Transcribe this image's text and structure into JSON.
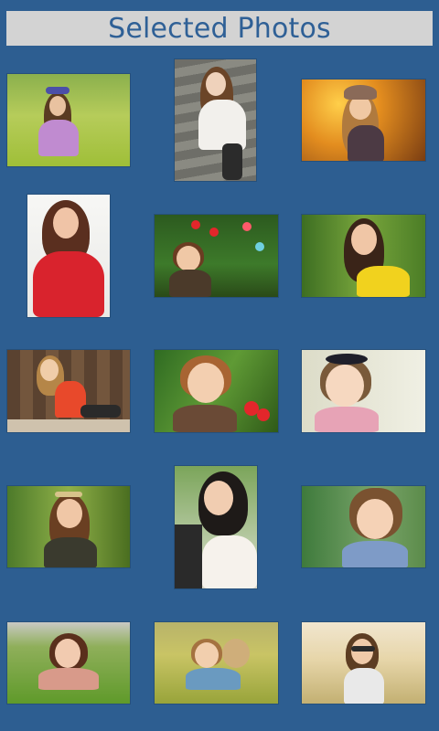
{
  "header": {
    "title": "Selected Photos"
  },
  "photos": [
    {
      "name": "girl-in-meadow"
    },
    {
      "name": "woman-on-stairs"
    },
    {
      "name": "girl-with-hat-sunset"
    },
    {
      "name": "woman-red-shirt"
    },
    {
      "name": "girl-with-red-flowers"
    },
    {
      "name": "woman-yellow-top"
    },
    {
      "name": "woman-wooden-door"
    },
    {
      "name": "girl-pigtails-red-flowers"
    },
    {
      "name": "girl-with-bow"
    },
    {
      "name": "woman-with-tiara"
    },
    {
      "name": "woman-white-top"
    },
    {
      "name": "curly-boy"
    },
    {
      "name": "girl-lying-in-grass"
    },
    {
      "name": "child-with-teddy"
    },
    {
      "name": "woman-sunglasses-field"
    }
  ]
}
